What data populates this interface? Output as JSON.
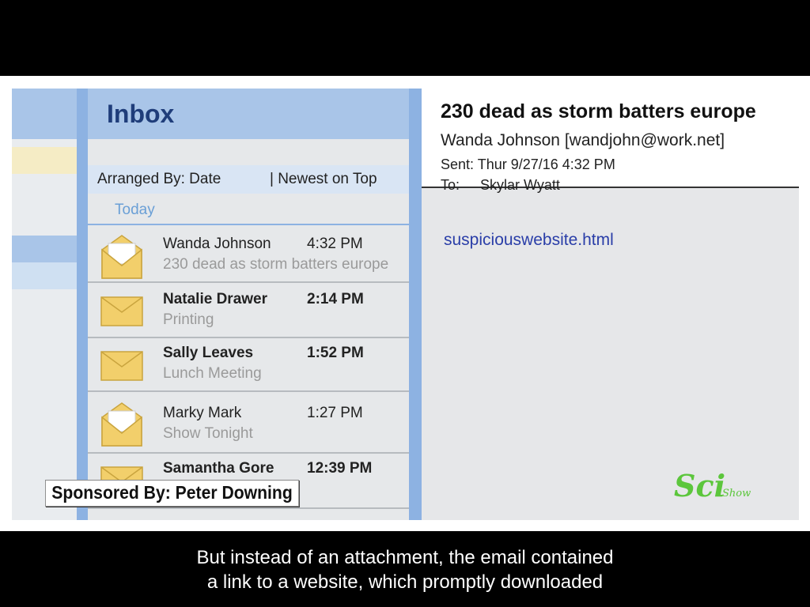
{
  "inbox": {
    "title": "Inbox",
    "arranged_by": "Arranged By: Date",
    "sort_order": "| Newest on Top",
    "group_today": "Today",
    "items": [
      {
        "sender": "Wanda Johnson",
        "time": "4:32 PM",
        "subject": "230 dead as storm batters europe",
        "unread": false,
        "icon": "open-envelope-icon"
      },
      {
        "sender": "Natalie Drawer",
        "time": "2:14 PM",
        "subject": "Printing",
        "unread": true,
        "icon": "closed-envelope-icon"
      },
      {
        "sender": "Sally Leaves",
        "time": "1:52 PM",
        "subject": "Lunch Meeting",
        "unread": true,
        "icon": "closed-envelope-icon"
      },
      {
        "sender": "Marky Mark",
        "time": "1:27 PM",
        "subject": "Show Tonight",
        "unread": false,
        "icon": "open-envelope-icon"
      },
      {
        "sender": "Samantha Gore",
        "time": "12:39 PM",
        "subject": "",
        "unread": true,
        "icon": "closed-envelope-icon"
      }
    ]
  },
  "reading_pane": {
    "subject": "230 dead as storm batters europe",
    "from": "Wanda Johnson [wandjohn@work.net]",
    "sent": "Sent: Thur 9/27/16 4:32 PM",
    "to_label": "To:",
    "to_value": "Skylar Wyatt",
    "link": "suspiciouswebsite.html"
  },
  "overlay": {
    "sponsor": "Sponsored By: Peter Downing",
    "logo_main": "Sci",
    "logo_sub": "Show"
  },
  "caption": {
    "line1": "But instead of an attachment, the email contained",
    "line2": "a link to a website, which promptly downloaded"
  },
  "colors": {
    "header_blue": "#a9c5e8",
    "rail_blue": "#8db2e2",
    "title_navy": "#1f3d7a",
    "envelope_yellow": "#f2cf6b",
    "link_blue": "#2a3ea8",
    "logo_green": "#5cc63c"
  }
}
